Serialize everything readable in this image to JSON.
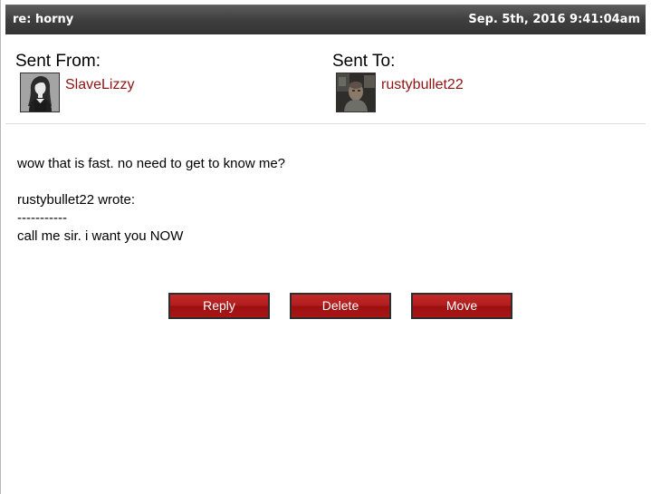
{
  "header": {
    "subject": "re: horny",
    "date": "Sep. 5th, 2016 9:41:04am"
  },
  "sender": {
    "label": "Sent From:",
    "username": "SlaveLizzy",
    "avatar_icon": "female-silhouette-avatar"
  },
  "recipient": {
    "label": "Sent To:",
    "username": "rustybullet22",
    "avatar_icon": "user-photo-avatar"
  },
  "message": {
    "lines": [
      "wow that is fast. no need to get to know me?",
      "",
      "rustybullet22 wrote:",
      "-----------",
      "call me sir. i want you NOW"
    ]
  },
  "actions": {
    "reply_label": "Reply",
    "delete_label": "Delete",
    "move_label": "Move"
  },
  "colors": {
    "header_bg": "#3f3f3f",
    "username_link": "#8f1313",
    "button_red": "#b11d1d"
  }
}
